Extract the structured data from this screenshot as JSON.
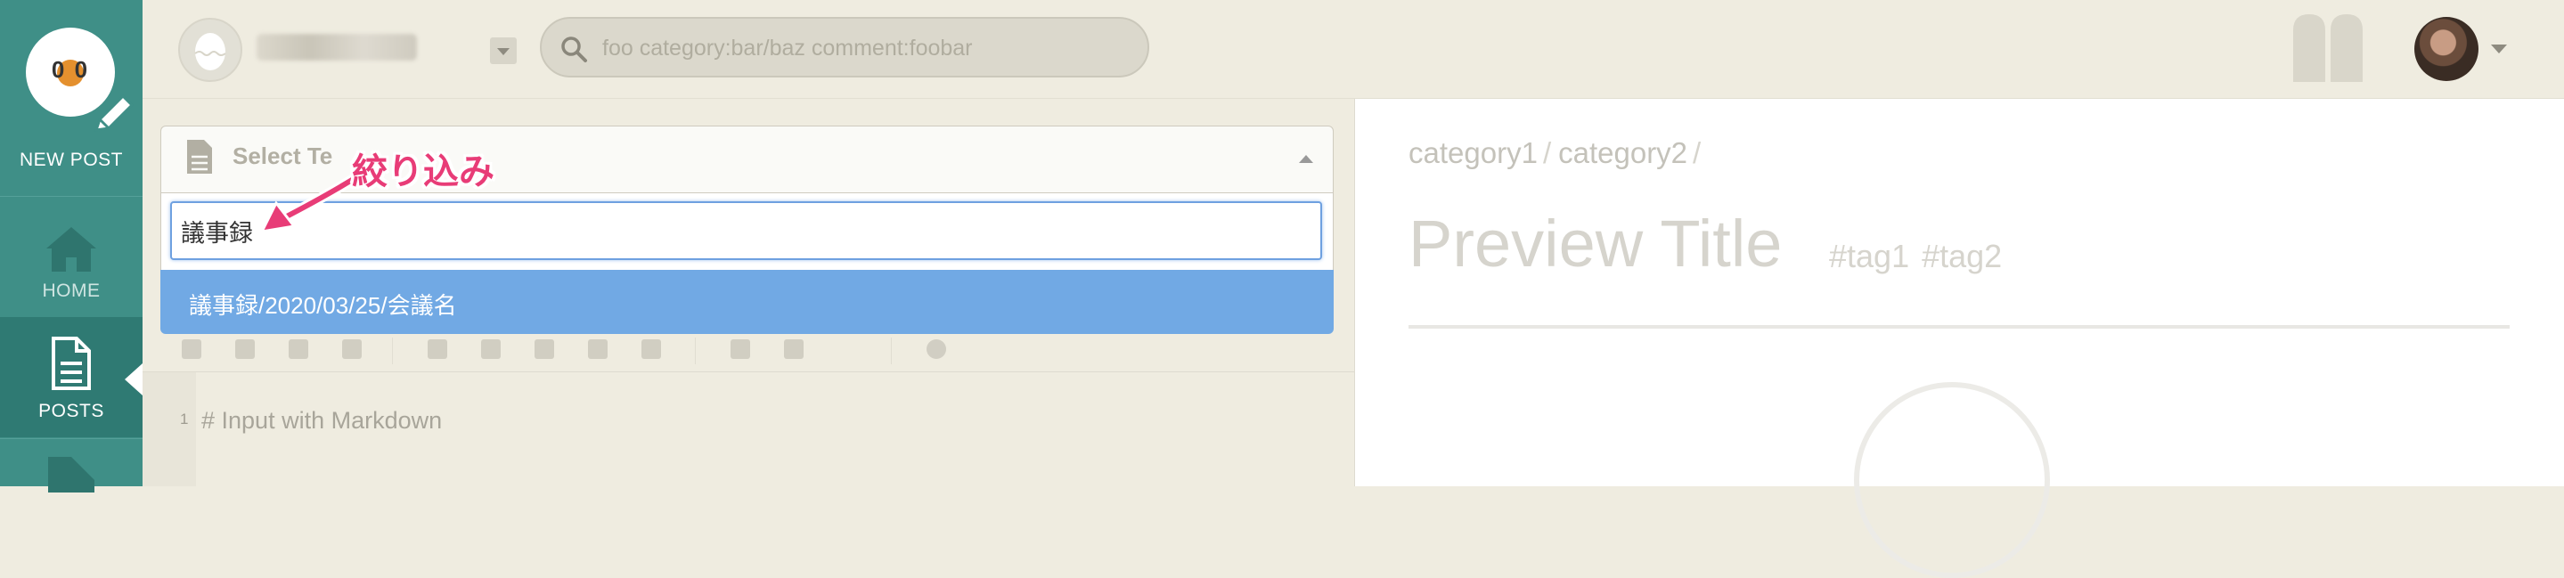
{
  "sidebar": {
    "logo_face": "0 0",
    "new_post_label": "NEW POST",
    "items": [
      {
        "label": "HOME",
        "icon": "home-icon"
      },
      {
        "label": "POSTS",
        "icon": "document-icon",
        "active": true
      },
      {
        "label": "",
        "icon": "tags-icon"
      }
    ],
    "accent": "#3f8f87"
  },
  "topbar": {
    "search_placeholder": "foo category:bar/baz comment:foobar",
    "search_value": ""
  },
  "editor": {
    "template_select_label": "Select Te",
    "filter_value": "議事録",
    "options": [
      "議事録/2020/03/25/会議名"
    ],
    "line_number": "1",
    "first_line": "# Input with Markdown"
  },
  "annotation": {
    "label": "絞り込み",
    "color": "#e83c77"
  },
  "preview": {
    "breadcrumb": [
      "category1",
      "category2"
    ],
    "separator": "/",
    "title": "Preview Title",
    "tags": [
      "#tag1",
      "#tag2"
    ]
  },
  "colors": {
    "selected_option": "#71a9e4",
    "logo_accent": "#e4902e"
  }
}
